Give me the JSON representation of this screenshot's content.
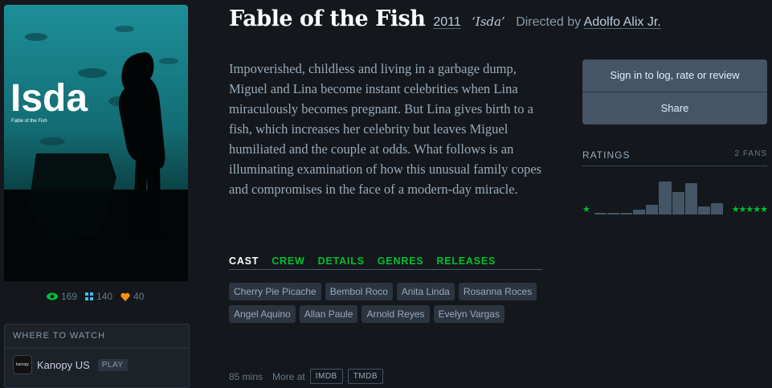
{
  "film": {
    "title": "Fable of the Fish",
    "year": "2011",
    "original_title": "‘Isda’",
    "directed_by_label": "Directed by",
    "director": "Adolfo Alix Jr.",
    "synopsis": "Impoverished, childless and living in a garbage dump, Miguel and Lina become instant celebrities when Lina miraculously becomes pregnant. But Lina gives birth to a fish, which increases her celebrity but leaves Miguel humiliated and the couple at odds. What follows is an illuminating examination of how this unusual family copes and compromises in the face of a modern-day miracle.",
    "runtime": "85 mins",
    "more_at_label": "More at"
  },
  "poster": {
    "title_text": "Isda",
    "subtitle_text": "Fable of the Fish"
  },
  "stats": {
    "watched": "169",
    "lists": "140",
    "likes": "40"
  },
  "where_to_watch": {
    "heading": "WHERE TO WATCH",
    "service": "Kanopy US",
    "service_logo_text": "kanopy",
    "play_label": "PLAY"
  },
  "tabs": [
    {
      "label": "CAST"
    },
    {
      "label": "CREW"
    },
    {
      "label": "DETAILS"
    },
    {
      "label": "GENRES"
    },
    {
      "label": "RELEASES"
    }
  ],
  "cast": [
    "Cherry Pie Picache",
    "Bembol Roco",
    "Anita Linda",
    "Rosanna Roces",
    "Angel Aquino",
    "Allan Paule",
    "Arnold Reyes",
    "Evelyn Vargas"
  ],
  "external_links": {
    "imdb": "IMDB",
    "tmdb": "TMDB"
  },
  "actions": {
    "sign_in": "Sign in to log, rate or review",
    "share": "Share"
  },
  "ratings": {
    "heading": "RATINGS",
    "fans": "2 FANS",
    "histogram": [
      0.03,
      0.04,
      0.04,
      0.11,
      0.22,
      0.75,
      0.5,
      0.7,
      0.18,
      0.25
    ],
    "bar_color": "#445566",
    "star_color": "#00c030",
    "low_star": "★",
    "high_stars": "★★★★★"
  },
  "colors": {
    "background": "#14181c",
    "accent_green": "#00c030",
    "heart_orange": "#ff9010",
    "list_blue": "#40bcf4"
  }
}
